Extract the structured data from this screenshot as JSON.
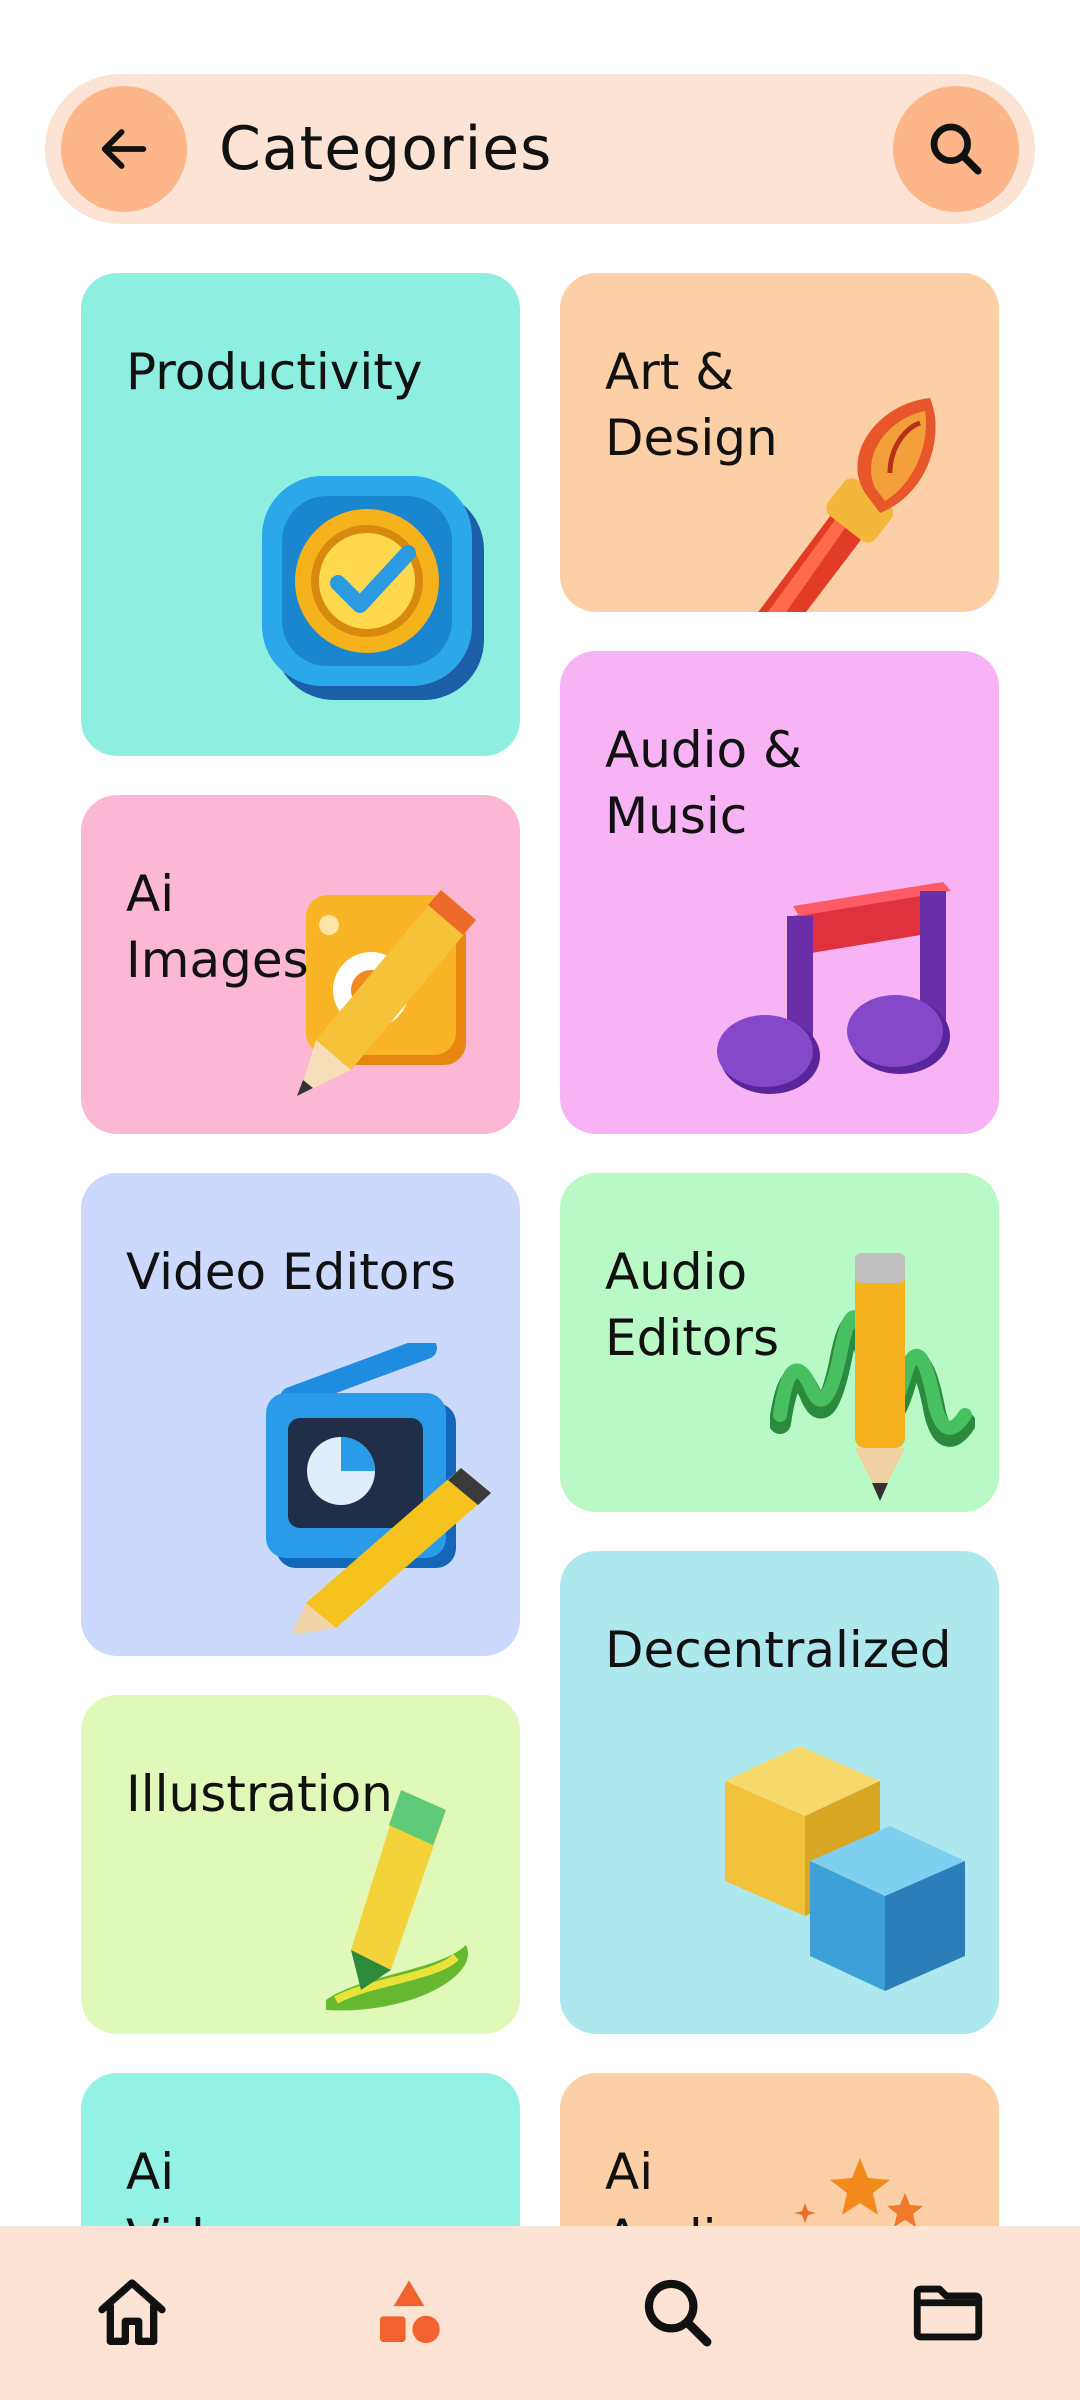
{
  "header": {
    "title": "Categories",
    "back_icon": "arrow-left-icon",
    "search_icon": "search-icon"
  },
  "categories": [
    {
      "label": "Productivity",
      "icon": "checkmark-clock-icon"
    },
    {
      "label": "Art &\nDesign",
      "icon": "paintbrush-icon"
    },
    {
      "label": "Ai\nImages",
      "icon": "image-pencil-icon"
    },
    {
      "label": "Audio &\nMusic",
      "icon": "music-note-icon"
    },
    {
      "label": "Video Editors",
      "icon": "video-edit-icon"
    },
    {
      "label": "Audio\nEditors",
      "icon": "waveform-pencil-icon"
    },
    {
      "label": "Illustration",
      "icon": "pen-stroke-icon"
    },
    {
      "label": "Decentralized",
      "icon": "cubes-icon"
    },
    {
      "label": "Ai\nVideo",
      "icon": "ai-video-icon"
    },
    {
      "label": "Ai\nAudio",
      "icon": "stars-icon"
    }
  ],
  "bottom_nav": [
    {
      "name": "home",
      "icon": "home-icon"
    },
    {
      "name": "categories",
      "icon": "shapes-icon",
      "active": true
    },
    {
      "name": "search",
      "icon": "search-icon"
    },
    {
      "name": "files",
      "icon": "folder-icon"
    }
  ],
  "colors": {
    "header_bg": "#fde3d3",
    "header_button": "#fdb68a",
    "accent": "#f2622e",
    "productivity": "#8eefe0",
    "art_design": "#fdcfa6",
    "ai_images": "#fbb7d3",
    "audio_music": "#f8b3f5",
    "video_editors": "#cbd9fc",
    "audio_editors": "#b8f9c5",
    "illustration": "#e0f9b8",
    "decentralized": "#aee8ef",
    "ai_video": "#93f2e4",
    "ai_audio": "#fdcfa6"
  }
}
